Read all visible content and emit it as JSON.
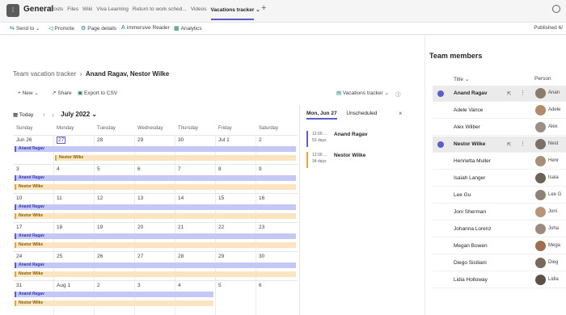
{
  "header": {
    "channel_icon": "team-icon",
    "channel_title": "General",
    "tabs": [
      "Posts",
      "Files",
      "Wiki",
      "Viva Learning",
      "Return to work sched...",
      "Videos",
      "Vacations tracker"
    ],
    "active_tab_chevron": "⌄"
  },
  "command_bar": {
    "send_to": "Send to",
    "promote": "Promote",
    "page_details": "Page details",
    "immersive_reader": "Immersive Reader",
    "analytics": "Analytics",
    "published": "Published 6/"
  },
  "breadcrumb": {
    "parent": "Team vacation tracker",
    "current": "Anand Ragav, Nestor Wilke"
  },
  "toolbar": {
    "new": "New",
    "share": "Share",
    "export": "Export to CSV",
    "view": "Vacations tracker"
  },
  "calendar": {
    "today": "Today",
    "month": "July 2022",
    "days": [
      "Sunday",
      "Monday",
      "Tuesday",
      "Wednesday",
      "Thursday",
      "Friday",
      "Saturday"
    ],
    "weeks": [
      [
        "Jun 26",
        "27",
        "28",
        "29",
        "30",
        "Jul 1",
        "2"
      ],
      [
        "3",
        "4",
        "5",
        "6",
        "7",
        "8",
        "9"
      ],
      [
        "10",
        "11",
        "12",
        "13",
        "14",
        "15",
        "16"
      ],
      [
        "17",
        "18",
        "19",
        "20",
        "21",
        "22",
        "23"
      ],
      [
        "24",
        "25",
        "26",
        "27",
        "28",
        "29",
        "30"
      ],
      [
        "31",
        "Aug 1",
        "2",
        "3",
        "4",
        "5",
        "6"
      ]
    ],
    "event_a": "Anand Ragav",
    "event_n": "Nestor Wilke",
    "accent_a": "#5b5fc7",
    "accent_n": "#e8a33d"
  },
  "day_panel": {
    "date_tab": "Mon, Jun 27",
    "unscheduled_tab": "Unscheduled",
    "events": [
      {
        "time": "12:00 ...",
        "duration": "53 days",
        "name": "Anand Ragav"
      },
      {
        "time": "12:00 ...",
        "duration": "34 days",
        "name": "Nestor Wilke"
      }
    ]
  },
  "team": {
    "title": "Team members",
    "col_title": "Title",
    "col_person": "Person",
    "members": [
      {
        "name": "Anand Ragav",
        "person": "Anan"
      },
      {
        "name": "Adele Vance",
        "person": "Adele"
      },
      {
        "name": "Alex Wilber",
        "person": "Alex"
      },
      {
        "name": "Nestor Wilke",
        "person": "Nest"
      },
      {
        "name": "Henrietta Muller",
        "person": "Henr"
      },
      {
        "name": "Isaiah Langer",
        "person": "Isaia"
      },
      {
        "name": "Lee Gu",
        "person": "Lee G"
      },
      {
        "name": "Joni Sherman",
        "person": "Joni"
      },
      {
        "name": "Johanna Lorenz",
        "person": "Joha"
      },
      {
        "name": "Megan Bowen",
        "person": "Mega"
      },
      {
        "name": "Diego Siciliani",
        "person": "Dieg"
      },
      {
        "name": "Lidia Holloway",
        "person": "Lidia"
      }
    ]
  }
}
